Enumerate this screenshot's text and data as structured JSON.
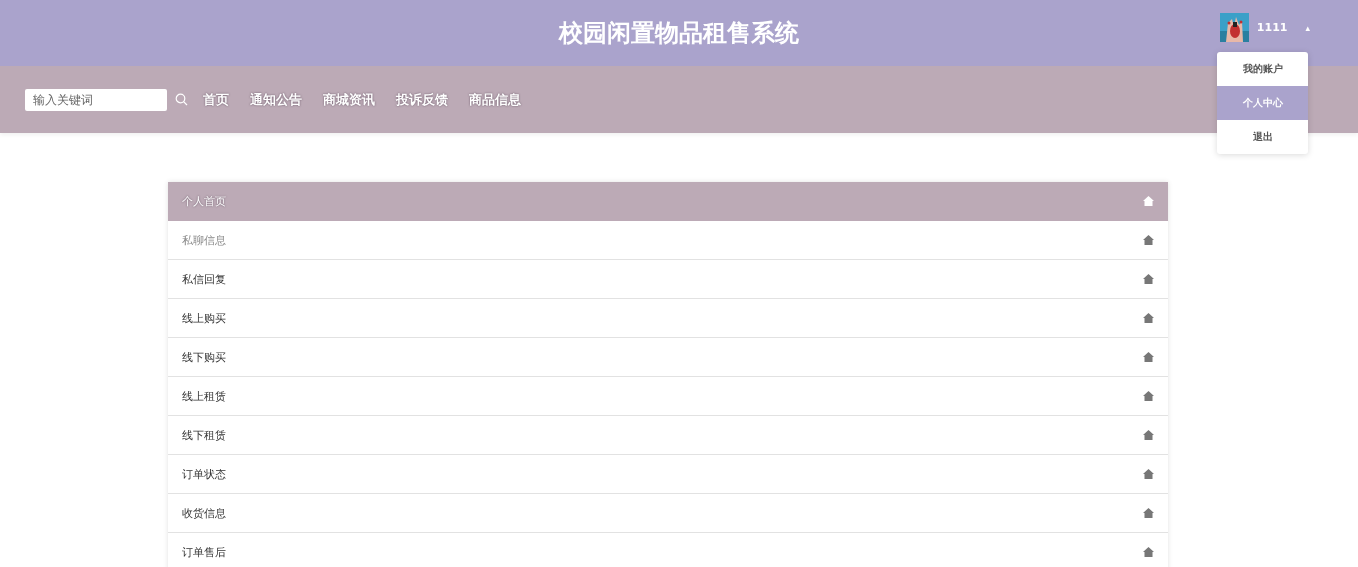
{
  "header": {
    "title": "校园闲置物品租售系统",
    "user": {
      "name": "1111",
      "menu_open": true,
      "caret": "▴"
    }
  },
  "user_menu": [
    {
      "label": "我的账户",
      "selected": false
    },
    {
      "label": "个人中心",
      "selected": true
    },
    {
      "label": "退出",
      "selected": false
    }
  ],
  "search": {
    "placeholder": "输入关键词"
  },
  "nav": [
    {
      "label": "首页"
    },
    {
      "label": "通知公告"
    },
    {
      "label": "商城资讯"
    },
    {
      "label": "投诉反馈"
    },
    {
      "label": "商品信息"
    }
  ],
  "menu": [
    {
      "label": "个人首页",
      "selected": true,
      "hovered": false
    },
    {
      "label": "私聊信息",
      "selected": false,
      "hovered": true
    },
    {
      "label": "私信回复",
      "selected": false,
      "hovered": false
    },
    {
      "label": "线上购买",
      "selected": false,
      "hovered": false
    },
    {
      "label": "线下购买",
      "selected": false,
      "hovered": false
    },
    {
      "label": "线上租赁",
      "selected": false,
      "hovered": false
    },
    {
      "label": "线下租赁",
      "selected": false,
      "hovered": false
    },
    {
      "label": "订单状态",
      "selected": false,
      "hovered": false
    },
    {
      "label": "收货信息",
      "selected": false,
      "hovered": false
    },
    {
      "label": "订单售后",
      "selected": false,
      "hovered": false
    }
  ]
}
